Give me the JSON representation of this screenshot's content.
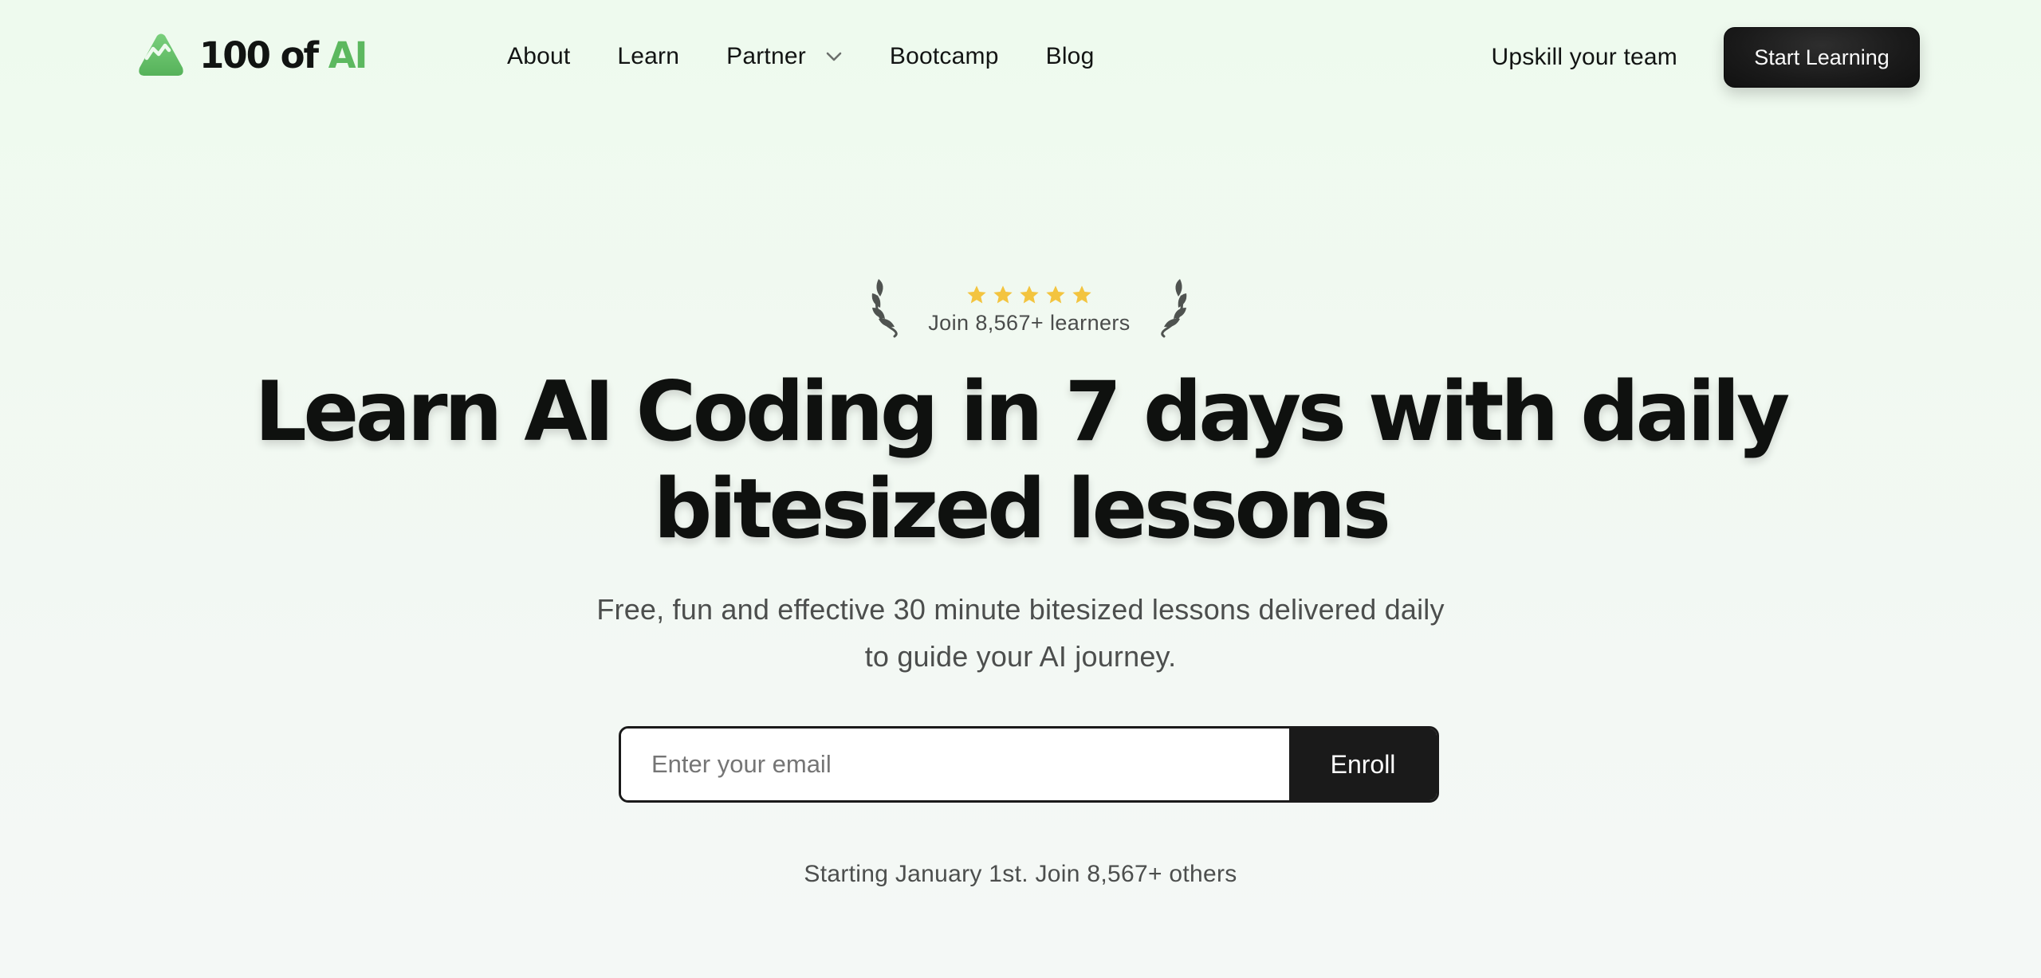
{
  "brand": {
    "name_prefix": "100 of ",
    "name_accent": "AI",
    "accent_color": "#5cb85f",
    "logo_icon": "mountain-icon"
  },
  "nav": {
    "links": [
      {
        "label": "About"
      },
      {
        "label": "Learn"
      },
      {
        "label": "Partner",
        "has_dropdown": true,
        "icon": "chevron-down-icon"
      },
      {
        "label": "Bootcamp"
      },
      {
        "label": "Blog"
      }
    ],
    "upskill_label": "Upskill your team",
    "cta_label": "Start Learning"
  },
  "hero": {
    "rating": {
      "stars": 5,
      "max_stars": 5,
      "star_color": "#f3c43f",
      "text": "Join 8,567+ learners",
      "decoration_icon": "laurel-icon"
    },
    "headline_line1": "Learn AI Coding in 7 days with daily",
    "headline_line2": "bitesized lessons",
    "subtitle_line1": "Free, fun and effective 30 minute bitesized lessons delivered daily",
    "subtitle_line2": "to guide your AI journey.",
    "form": {
      "email_placeholder": "Enter your email",
      "email_value": "",
      "submit_label": "Enroll"
    },
    "footnote": "Starting January 1st. Join 8,567+ others"
  }
}
